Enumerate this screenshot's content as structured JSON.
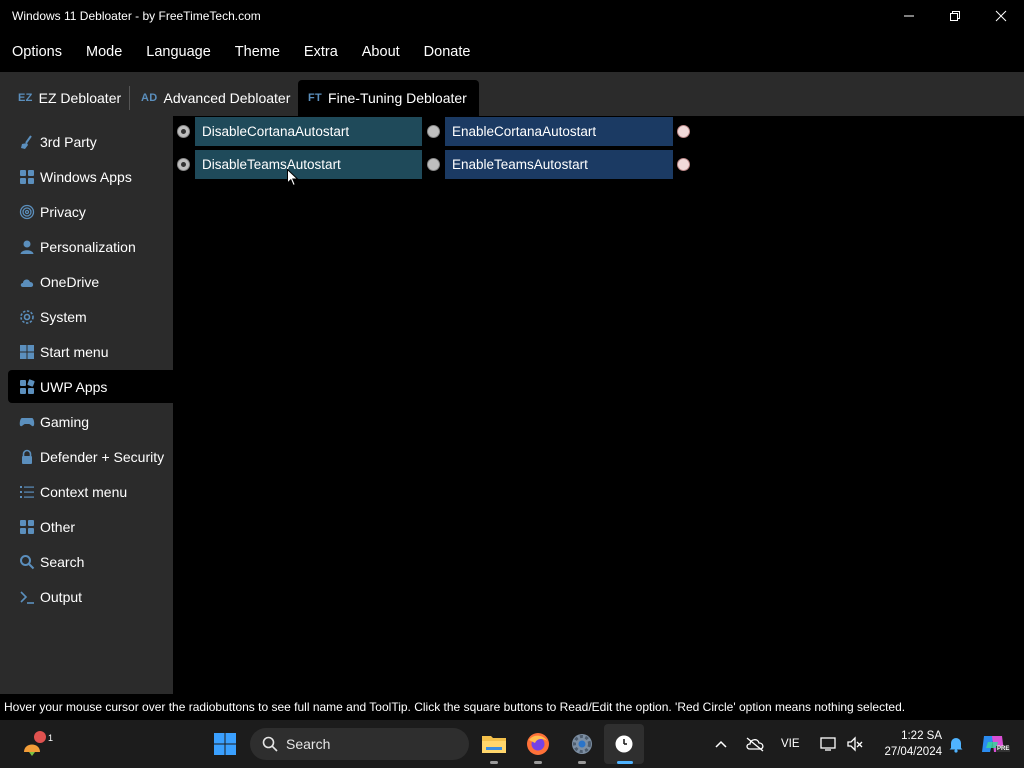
{
  "window": {
    "title": "Windows 11 Debloater - by FreeTimeTech.com"
  },
  "menu": {
    "items": [
      "Options",
      "Mode",
      "Language",
      "Theme",
      "Extra",
      "About",
      "Donate"
    ]
  },
  "tabs": [
    {
      "abbr": "EZ",
      "label": "EZ Debloater"
    },
    {
      "abbr": "AD",
      "label": "Advanced Debloater"
    },
    {
      "abbr": "FT",
      "label": "Fine-Tuning Debloater"
    }
  ],
  "active_tab": "Fine-Tuning Debloater",
  "sidebar": {
    "items": [
      {
        "label": "3rd Party",
        "icon": "broom-icon"
      },
      {
        "label": "Windows Apps",
        "icon": "apps-grid-icon"
      },
      {
        "label": "Privacy",
        "icon": "fingerprint-icon"
      },
      {
        "label": "Personalization",
        "icon": "person-icon"
      },
      {
        "label": "OneDrive",
        "icon": "cloud-icon"
      },
      {
        "label": "System",
        "icon": "gear-icon"
      },
      {
        "label": "Start menu",
        "icon": "windows-logo-icon"
      },
      {
        "label": "UWP Apps",
        "icon": "apps-add-icon"
      },
      {
        "label": "Gaming",
        "icon": "gamepad-icon"
      },
      {
        "label": "Defender + Security",
        "icon": "lock-icon"
      },
      {
        "label": "Context menu",
        "icon": "list-icon"
      },
      {
        "label": "Other",
        "icon": "apps-grid-icon"
      },
      {
        "label": "Search",
        "icon": "search-icon"
      },
      {
        "label": "Output",
        "icon": "terminal-icon"
      }
    ],
    "active": "UWP Apps"
  },
  "options": [
    {
      "disable_label": "DisableCortanaAutostart",
      "enable_label": "EnableCortanaAutostart",
      "state": "none"
    },
    {
      "disable_label": "DisableTeamsAutostart",
      "enable_label": "EnableTeamsAutostart",
      "state": "none"
    }
  ],
  "status": {
    "text": "Hover your mouse cursor over the radiobuttons to see full name and ToolTip. Click the square buttons to Read/Edit the option. 'Red Circle' option means nothing selected."
  },
  "taskbar": {
    "search_label": "Search",
    "language": "VIE",
    "time": "1:22 SA",
    "date": "27/04/2024",
    "widget_badge": "1",
    "copilot_badge": "PRE"
  },
  "colors": {
    "accent_blue": "#5b8fbd",
    "disable_button": "#1f4a5a",
    "enable_button": "#1b3a63",
    "sidebar_bg": "#2b2b2b"
  }
}
